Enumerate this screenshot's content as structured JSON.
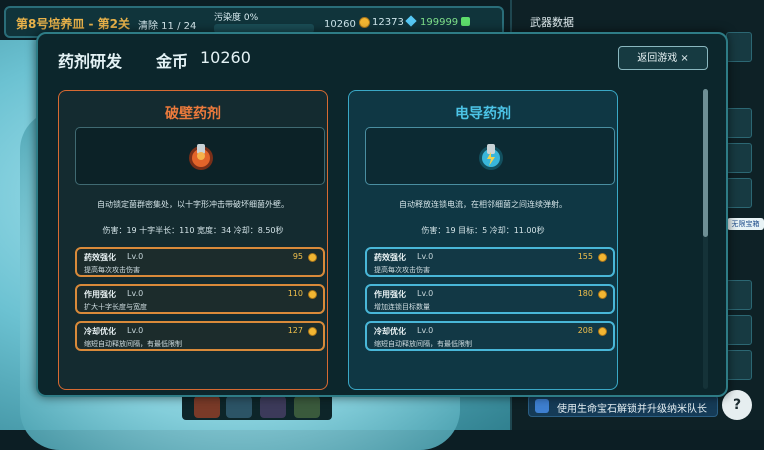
{
  "hud": {
    "stage": "第8号培养皿 - 第2关",
    "clear_label": "清除 11 / 24",
    "pollution_label": "污染度 0%",
    "gold": "10260",
    "crystals": "12373",
    "gems": "199999"
  },
  "side": {
    "title": "武器数据",
    "badge": "无限宝箱",
    "tip": "使用生命宝石解锁并升级纳米队长",
    "help": "?"
  },
  "modal": {
    "title": "药剂研发",
    "gold_label": "金币",
    "gold_value": "10260",
    "back_label": "返回游戏 ×"
  },
  "cards": [
    {
      "title": "破壁药剂",
      "desc": "自动锁定菌群密集处，以十字形冲击带破坏细菌外壁。",
      "stats": "伤害：19   十字半长：110   宽度：34   冷却：8.50秒",
      "upgrades": [
        {
          "name": "药效强化",
          "level": "Lv.0",
          "cost": "95",
          "desc": "提高每次攻击伤害"
        },
        {
          "name": "作用强化",
          "level": "Lv.0",
          "cost": "110",
          "desc": "扩大十字长度与宽度"
        },
        {
          "name": "冷却优化",
          "level": "Lv.0",
          "cost": "127",
          "desc": "缩短自动释放间隔，有最低限制"
        }
      ]
    },
    {
      "title": "电导药剂",
      "desc": "自动释放连锁电流，在相邻细菌之间连续弹射。",
      "stats": "伤害：19   目标：5   冷却：11.00秒",
      "upgrades": [
        {
          "name": "药效强化",
          "level": "Lv.0",
          "cost": "155",
          "desc": "提高每次攻击伤害"
        },
        {
          "name": "作用强化",
          "level": "Lv.0",
          "cost": "180",
          "desc": "增加连锁目标数量"
        },
        {
          "name": "冷却优化",
          "level": "Lv.0",
          "cost": "208",
          "desc": "缩短自动释放间隔，有最低限制"
        }
      ]
    }
  ],
  "icons": {
    "coin": "coin-icon",
    "crystal": "crystal-icon",
    "gem": "gem-icon",
    "potion_orange": "orange-potion-icon",
    "potion_blue": "blue-potion-icon"
  }
}
